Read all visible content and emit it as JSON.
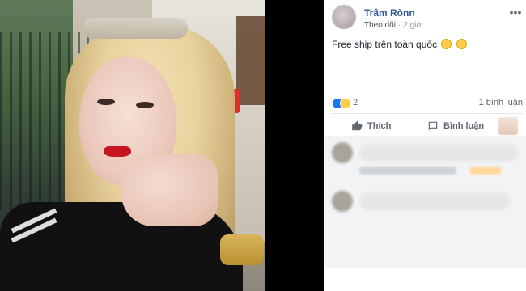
{
  "post": {
    "author": "Trâm Rònn",
    "follow_label": "Theo dõi",
    "separator": "·",
    "time": "2 giờ",
    "text": "Free ship trên toàn quốc",
    "emojis": [
      "rolling-on-floor-laughing-emoji",
      "rolling-on-floor-laughing-emoji"
    ],
    "reactions": {
      "count": "2",
      "types": [
        "like",
        "haha"
      ],
      "comments_label": "1 bình luận"
    },
    "actions": {
      "like_label": "Thích",
      "comment_label": "Bình luận"
    }
  },
  "colors": {
    "name_link": "#365899",
    "meta_text": "#90949c",
    "like_blue": "#1877f2",
    "haha_yellow": "#ffcc4d"
  }
}
